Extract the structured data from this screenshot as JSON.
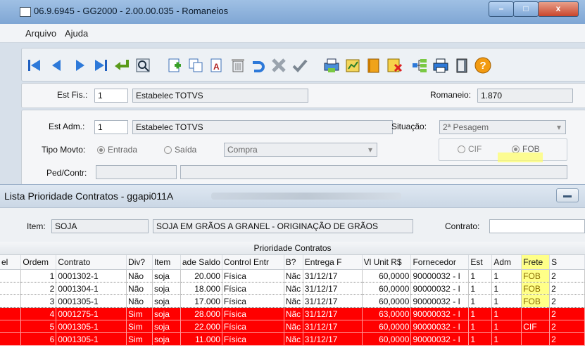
{
  "main_window": {
    "title": "06.9.6945 - GG2000 - 2.00.00.035 - Romaneios",
    "controls": [
      "–",
      "□",
      "x"
    ],
    "menu": [
      "Arquivo",
      "Ajuda"
    ],
    "toolbar_icons": [
      "first-icon",
      "prev-icon",
      "next-icon",
      "last-icon",
      "enter-icon",
      "search-icon",
      "new-icon",
      "copy-icon",
      "edit-icon",
      "delete-icon",
      "undo-icon",
      "cancel-icon",
      "confirm-icon",
      "print-icon",
      "report-icon",
      "book-icon",
      "filter-icon",
      "tree-icon",
      "printer-icon",
      "exit-icon",
      "help-icon"
    ],
    "est_fis": {
      "label": "Est Fis.:",
      "code": "1",
      "name": "Estabelec TOTVS"
    },
    "romaneio": {
      "label": "Romaneio:",
      "value": "1.870"
    },
    "est_adm": {
      "label": "Est Adm.:",
      "code": "1",
      "name": "Estabelec TOTVS"
    },
    "situacao": {
      "label": "Situação:",
      "value": "2ª Pesagem"
    },
    "tipo_movto": {
      "label": "Tipo Movto:",
      "opt1": "Entrada",
      "opt2": "Saída",
      "value": "Compra"
    },
    "frete_opts": {
      "cif": "CIF",
      "fob": "FOB"
    },
    "ped_contr": {
      "label": "Ped/Contr:"
    }
  },
  "list_window": {
    "title": "Lista Prioridade Contratos - ggapi011A",
    "item": {
      "label": "Item:",
      "code": "SOJA",
      "desc": "SOJA EM GRÃOS A GRANEL - ORIGINAÇÃO DE GRÃOS"
    },
    "contrato_label": "Contrato:",
    "grid_title": "Prioridade Contratos",
    "columns": [
      "el",
      "Ordem",
      "Contrato",
      "Div?",
      "Item",
      "ade Saldo",
      "Control Entr",
      "B?",
      "Entrega F",
      "Vl Unit R$",
      "Fornecedor",
      "Est",
      "Adm",
      "Frete",
      "S"
    ],
    "rows": [
      {
        "style": "w",
        "cells": [
          "",
          "1",
          "0001302-1",
          "Não",
          "soja",
          "20.000",
          "Física",
          "Nãc",
          "31/12/17",
          "60,0000",
          "90000032 - I",
          "1",
          "1",
          "FOB",
          "2"
        ]
      },
      {
        "style": "w",
        "cells": [
          "",
          "2",
          "0001304-1",
          "Não",
          "soja",
          "18.000",
          "Física",
          "Nãc",
          "31/12/17",
          "60,0000",
          "90000032 - I",
          "1",
          "1",
          "FOB",
          "2"
        ]
      },
      {
        "style": "w",
        "cells": [
          "",
          "3",
          "0001305-1",
          "Não",
          "soja",
          "17.000",
          "Física",
          "Nãc",
          "31/12/17",
          "60,0000",
          "90000032 - I",
          "1",
          "1",
          "FOB",
          "2"
        ]
      },
      {
        "style": "r",
        "cells": [
          "",
          "4",
          "0001275-1",
          "Sim",
          "soja",
          "28.000",
          "Física",
          "Nãc",
          "31/12/17",
          "63,0000",
          "90000032 - I",
          "1",
          "1",
          "",
          "2"
        ]
      },
      {
        "style": "r",
        "cells": [
          "",
          "5",
          "0001305-1",
          "Sim",
          "soja",
          "22.000",
          "Física",
          "Nãc",
          "31/12/17",
          "60,0000",
          "90000032 - I",
          "1",
          "1",
          "CIF",
          "2"
        ]
      },
      {
        "style": "r",
        "cells": [
          "",
          "6",
          "0001305-1",
          "Sim",
          "soja",
          "11.000",
          "Física",
          "Nãc",
          "31/12/17",
          "60,0000",
          "90000032 - I",
          "1",
          "1",
          "",
          "2"
        ]
      }
    ]
  },
  "colors": {
    "highlight": "#ffff66",
    "red_row": "#ff0000",
    "title_gradient": "#9fc0e4"
  }
}
